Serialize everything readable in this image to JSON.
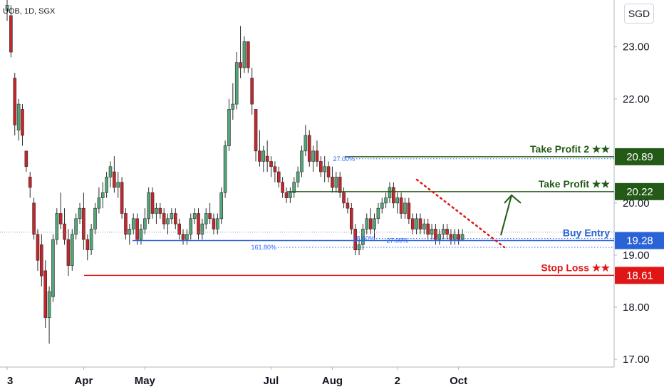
{
  "header": {
    "title": "UOB, 1D, SGX",
    "currency": "SGD"
  },
  "colors": {
    "up": "#53a67a",
    "down": "#c6262a",
    "take_profit": "#235a17",
    "buy": "#2a63d6",
    "stop": "#e01616",
    "fib": "#2962ff"
  },
  "chart_data": {
    "type": "candlestick",
    "title": "UOB, 1D, SGX",
    "currency": "SGD",
    "yticks": [
      "23.00",
      "22.00",
      "20.00",
      "19.00",
      "18.00",
      "17.00"
    ],
    "ytick_values": [
      23,
      22,
      20,
      19,
      18,
      17
    ],
    "ylim": [
      16.85,
      23.9
    ],
    "xticks": [
      "3",
      "Apr",
      "May",
      "Jul",
      "Aug",
      "2",
      "Oct"
    ],
    "xtick_index": [
      0,
      20,
      36,
      69,
      85,
      102,
      118
    ],
    "x_count": 134,
    "candles": [
      [
        23.7,
        23.9,
        23.5,
        23.8
      ],
      [
        23.6,
        23.8,
        22.8,
        22.9
      ],
      [
        22.4,
        22.5,
        21.3,
        21.5
      ],
      [
        21.4,
        22.0,
        21.2,
        21.9
      ],
      [
        21.8,
        21.9,
        21.1,
        21.3
      ],
      [
        21.0,
        21.0,
        20.6,
        20.7
      ],
      [
        20.5,
        20.6,
        20.1,
        20.3
      ],
      [
        20.0,
        20.1,
        19.3,
        19.4
      ],
      [
        19.4,
        19.5,
        18.7,
        18.9
      ],
      [
        19.2,
        19.4,
        18.4,
        18.6
      ],
      [
        18.7,
        18.9,
        17.6,
        17.8
      ],
      [
        17.8,
        18.4,
        17.3,
        18.3
      ],
      [
        18.2,
        19.4,
        18.1,
        19.3
      ],
      [
        19.3,
        19.9,
        19.2,
        19.8
      ],
      [
        19.8,
        20.2,
        19.5,
        19.6
      ],
      [
        19.6,
        19.9,
        19.2,
        19.3
      ],
      [
        19.3,
        19.5,
        18.6,
        18.8
      ],
      [
        18.8,
        19.5,
        18.7,
        19.4
      ],
      [
        19.4,
        19.8,
        19.3,
        19.7
      ],
      [
        19.7,
        20.0,
        19.6,
        19.9
      ],
      [
        19.9,
        20.2,
        19.1,
        19.3
      ],
      [
        19.3,
        19.4,
        18.9,
        19.1
      ],
      [
        19.1,
        19.6,
        19.0,
        19.5
      ],
      [
        19.5,
        20.0,
        19.4,
        19.9
      ],
      [
        19.9,
        20.3,
        19.8,
        20.1
      ],
      [
        20.1,
        20.4,
        19.9,
        20.2
      ],
      [
        20.2,
        20.6,
        20.1,
        20.5
      ],
      [
        20.5,
        20.8,
        20.3,
        20.7
      ],
      [
        20.6,
        20.9,
        20.2,
        20.3
      ],
      [
        20.3,
        20.6,
        20.1,
        20.4
      ],
      [
        20.4,
        20.5,
        19.7,
        19.8
      ],
      [
        19.8,
        19.9,
        19.3,
        19.4
      ],
      [
        19.4,
        19.6,
        19.2,
        19.5
      ],
      [
        19.5,
        19.8,
        19.4,
        19.7
      ],
      [
        19.7,
        19.8,
        19.2,
        19.3
      ],
      [
        19.3,
        19.6,
        19.2,
        19.5
      ],
      [
        19.5,
        19.9,
        19.4,
        19.7
      ],
      [
        19.7,
        20.3,
        19.6,
        20.2
      ],
      [
        20.2,
        20.3,
        19.7,
        19.8
      ],
      [
        19.8,
        20.0,
        19.6,
        19.9
      ],
      [
        19.9,
        20.0,
        19.7,
        19.8
      ],
      [
        19.8,
        19.9,
        19.5,
        19.6
      ],
      [
        19.6,
        19.8,
        19.4,
        19.7
      ],
      [
        19.7,
        19.9,
        19.6,
        19.8
      ],
      [
        19.8,
        19.9,
        19.5,
        19.6
      ],
      [
        19.6,
        19.7,
        19.3,
        19.4
      ],
      [
        19.4,
        19.5,
        19.2,
        19.3
      ],
      [
        19.3,
        19.5,
        19.2,
        19.4
      ],
      [
        19.4,
        19.8,
        19.3,
        19.7
      ],
      [
        19.7,
        19.9,
        19.6,
        19.8
      ],
      [
        19.8,
        19.9,
        19.3,
        19.4
      ],
      [
        19.4,
        19.7,
        19.3,
        19.6
      ],
      [
        19.6,
        19.9,
        19.5,
        19.8
      ],
      [
        19.8,
        20.0,
        19.6,
        19.7
      ],
      [
        19.7,
        19.8,
        19.4,
        19.5
      ],
      [
        19.5,
        19.8,
        19.4,
        19.7
      ],
      [
        19.7,
        20.3,
        19.6,
        20.2
      ],
      [
        20.2,
        21.2,
        20.1,
        21.1
      ],
      [
        21.1,
        22.0,
        21.0,
        21.8
      ],
      [
        21.8,
        22.3,
        21.6,
        21.9
      ],
      [
        21.9,
        22.9,
        21.8,
        22.7
      ],
      [
        22.7,
        23.4,
        22.4,
        22.6
      ],
      [
        22.6,
        23.2,
        22.5,
        23.1
      ],
      [
        23.1,
        23.1,
        22.5,
        22.6
      ],
      [
        22.4,
        22.6,
        21.7,
        21.9
      ],
      [
        21.8,
        21.8,
        20.8,
        21.0
      ],
      [
        21.0,
        21.4,
        20.7,
        20.8
      ],
      [
        20.8,
        21.1,
        20.6,
        21.0
      ],
      [
        20.9,
        21.2,
        20.6,
        20.8
      ],
      [
        20.8,
        20.9,
        20.5,
        20.7
      ],
      [
        20.7,
        20.8,
        20.4,
        20.6
      ],
      [
        20.6,
        20.7,
        20.3,
        20.4
      ],
      [
        20.4,
        20.5,
        20.1,
        20.2
      ],
      [
        20.2,
        20.3,
        20.0,
        20.1
      ],
      [
        20.1,
        20.3,
        20.0,
        20.2
      ],
      [
        20.2,
        20.5,
        20.1,
        20.4
      ],
      [
        20.4,
        20.7,
        20.3,
        20.6
      ],
      [
        20.6,
        21.1,
        20.5,
        21.0
      ],
      [
        21.0,
        21.5,
        20.9,
        21.3
      ],
      [
        21.3,
        21.4,
        20.7,
        20.8
      ],
      [
        20.8,
        21.1,
        20.6,
        21.0
      ],
      [
        21.0,
        21.2,
        20.7,
        20.8
      ],
      [
        20.8,
        20.9,
        20.5,
        20.6
      ],
      [
        20.6,
        20.9,
        20.4,
        20.7
      ],
      [
        20.7,
        20.8,
        20.4,
        20.5
      ],
      [
        20.5,
        20.7,
        20.2,
        20.3
      ],
      [
        20.3,
        20.6,
        20.2,
        20.5
      ],
      [
        20.5,
        20.6,
        20.1,
        20.2
      ],
      [
        20.2,
        20.3,
        19.9,
        20.0
      ],
      [
        20.0,
        20.1,
        19.8,
        19.9
      ],
      [
        19.9,
        20.0,
        19.4,
        19.5
      ],
      [
        19.5,
        19.6,
        19.0,
        19.1
      ],
      [
        19.1,
        19.3,
        19.0,
        19.2
      ],
      [
        19.2,
        19.6,
        19.1,
        19.5
      ],
      [
        19.5,
        19.8,
        19.4,
        19.7
      ],
      [
        19.7,
        19.9,
        19.4,
        19.5
      ],
      [
        19.5,
        19.8,
        19.3,
        19.7
      ],
      [
        19.7,
        20.0,
        19.6,
        19.9
      ],
      [
        19.9,
        20.1,
        19.8,
        20.0
      ],
      [
        20.0,
        20.2,
        19.9,
        20.1
      ],
      [
        20.1,
        20.4,
        20.0,
        20.3
      ],
      [
        20.3,
        20.4,
        19.9,
        20.0
      ],
      [
        20.0,
        20.2,
        19.8,
        20.1
      ],
      [
        20.1,
        20.2,
        19.7,
        19.8
      ],
      [
        19.8,
        20.1,
        19.7,
        20.0
      ],
      [
        20.0,
        20.1,
        19.6,
        19.7
      ],
      [
        19.7,
        19.8,
        19.4,
        19.5
      ],
      [
        19.5,
        19.8,
        19.4,
        19.7
      ],
      [
        19.7,
        19.8,
        19.4,
        19.5
      ],
      [
        19.5,
        19.7,
        19.4,
        19.6
      ],
      [
        19.6,
        19.7,
        19.3,
        19.4
      ],
      [
        19.4,
        19.6,
        19.3,
        19.5
      ],
      [
        19.5,
        19.6,
        19.2,
        19.3
      ],
      [
        19.3,
        19.5,
        19.2,
        19.4
      ],
      [
        19.4,
        19.6,
        19.3,
        19.5
      ],
      [
        19.5,
        19.6,
        19.3,
        19.4
      ],
      [
        19.4,
        19.5,
        19.2,
        19.3
      ],
      [
        19.3,
        19.5,
        19.2,
        19.4
      ],
      [
        19.4,
        19.5,
        19.2,
        19.3
      ],
      [
        19.3,
        19.5,
        19.3,
        19.4
      ]
    ],
    "levels": [
      {
        "label": "Take Profit 2 ★★",
        "price": 20.89,
        "tag": "20.89",
        "color": "#235a17",
        "style": "solid"
      },
      {
        "label": "Take Profit ★★",
        "price": 20.22,
        "tag": "20.22",
        "color": "#235a17",
        "style": "solid"
      },
      {
        "label": "Buy Entry",
        "price": 19.28,
        "tag": "19.28",
        "color": "#2a63d6",
        "style": "solid"
      },
      {
        "label": "Stop Loss ★★",
        "price": 18.61,
        "tag": "18.61",
        "color": "#e01616",
        "style": "solid"
      }
    ],
    "fib_levels": [
      {
        "label": "27.00%",
        "price": 20.85
      },
      {
        "label": "78.60%",
        "price": 19.32
      },
      {
        "label": "27.00%",
        "price": 19.28
      },
      {
        "label": "161.80%",
        "price": 19.15
      }
    ],
    "current_price": 19.44
  }
}
